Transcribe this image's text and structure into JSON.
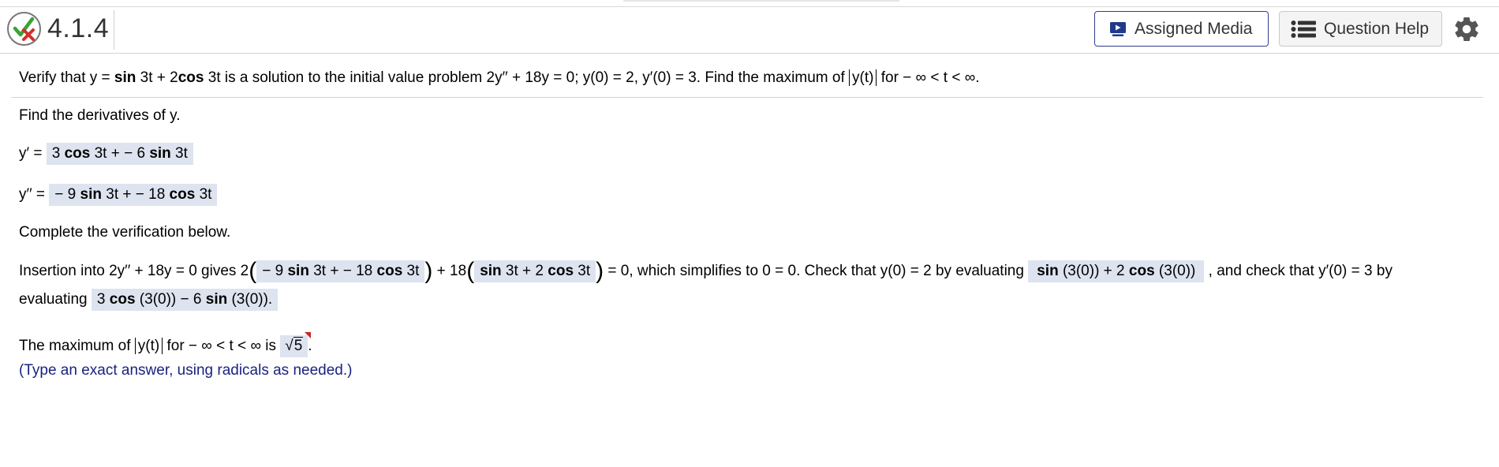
{
  "header": {
    "question_number": "4.1.4",
    "assigned_media_label": "Assigned Media",
    "question_help_label": "Question Help",
    "status": "partially correct"
  },
  "problem": {
    "p1": "Verify that y = ",
    "sin": "sin",
    "p2": " 3t + 2",
    "cos": "cos",
    "p3": " 3t is a solution to the initial value problem 2y′′ + 18y = 0; y(0) = 2, y′(0) = 3. Find the maximum of ",
    "abs_y": "y(t)",
    "p4": " for  − ∞ < t < ∞."
  },
  "derivatives": {
    "prompt": "Find the derivatives of y.",
    "yp_label": "y′ = ",
    "yp_a": "3 ",
    "yp_b": " 3t +  − 6 ",
    "yp_c": " 3t",
    "ypp_label": "y′′ = ",
    "ypp_a": " − 9 ",
    "ypp_b": " 3t +  − 18 ",
    "ypp_c": " 3t"
  },
  "verification": {
    "prompt": "Complete the verification below.",
    "t1": "Insertion into 2y′′ + 18y = 0 gives 2",
    "box1_a": " − 9 ",
    "box1_b": " 3t +  − 18 ",
    "box1_c": " 3t",
    "t2": " + 18",
    "box2_b": " 3t  + 2 ",
    "box2_c": " 3t",
    "t3": " = 0, which simplifies to 0 = 0. Check that y(0) = 2 by evaluating ",
    "box3_b": " (3(0)) + 2 ",
    "box3_c": " (3(0))",
    "t4": " , and check that y′(0) = 3 by",
    "t5": "evaluating ",
    "box4_a": "3 ",
    "box4_b": " (3(0)) − 6 ",
    "box4_c": " (3(0))."
  },
  "answer": {
    "t1": "The maximum of ",
    "abs_y": "y(t)",
    "t2": " for  − ∞ < t < ∞ is ",
    "radicand": "5",
    "t3": ".",
    "hint": "(Type an exact answer, using radicals as needed.)"
  },
  "colors": {
    "answer_box": "#dde3ef",
    "hint_text": "#1a237e",
    "media_border": "#2f3e8f",
    "check_green": "#3aa335",
    "x_red": "#d32f2f"
  }
}
